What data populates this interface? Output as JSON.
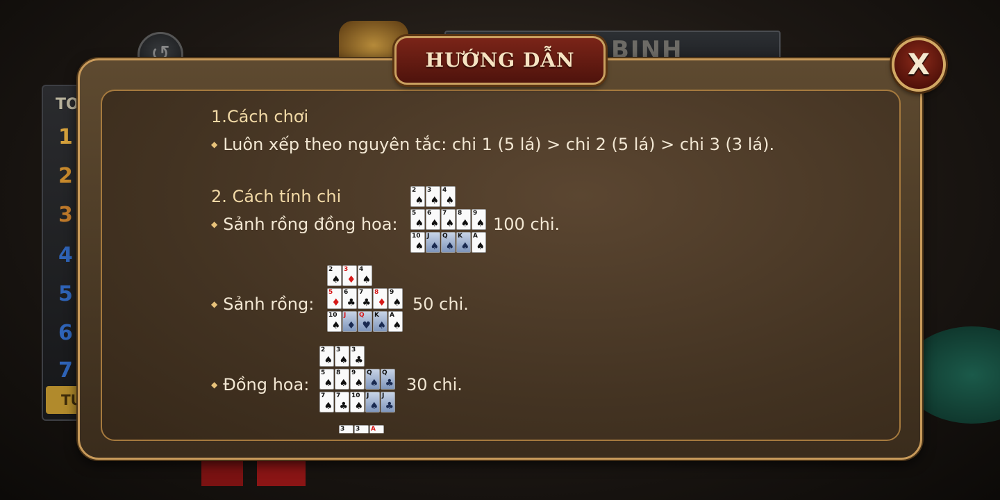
{
  "background": {
    "game_title": "BINH",
    "leaderboard_header": "TO",
    "ranks": [
      "1",
      "2",
      "3",
      "4",
      "5",
      "6",
      "7"
    ],
    "leaderboard_footer": "TU"
  },
  "dialog": {
    "title": "HƯỚNG DẪN",
    "close_label": "X",
    "section1_title": "1.Cách chơi",
    "section1_rule": "Luôn xếp theo nguyên tắc: chi 1 (5 lá) > chi 2 (5 lá) > chi 3 (3 lá).",
    "section2_title": "2. Cách tính chi",
    "hands": [
      {
        "label": "Sảnh rồng đồng hoa:",
        "score": "100 chi.",
        "rows": [
          [
            {
              "rank": "2",
              "suit": "♠"
            },
            {
              "rank": "3",
              "suit": "♠"
            },
            {
              "rank": "4",
              "suit": "♠"
            }
          ],
          [
            {
              "rank": "5",
              "suit": "♠"
            },
            {
              "rank": "6",
              "suit": "♠"
            },
            {
              "rank": "7",
              "suit": "♠"
            },
            {
              "rank": "8",
              "suit": "♠"
            },
            {
              "rank": "9",
              "suit": "♠"
            }
          ],
          [
            {
              "rank": "10",
              "suit": "♠"
            },
            {
              "rank": "J",
              "suit": "♠"
            },
            {
              "rank": "Q",
              "suit": "♠"
            },
            {
              "rank": "K",
              "suit": "♠"
            },
            {
              "rank": "A",
              "suit": "♠"
            }
          ]
        ]
      },
      {
        "label": "Sảnh rồng:",
        "score": "50 chi.",
        "rows": [
          [
            {
              "rank": "2",
              "suit": "♠"
            },
            {
              "rank": "3",
              "suit": "♦"
            },
            {
              "rank": "4",
              "suit": "♠"
            }
          ],
          [
            {
              "rank": "5",
              "suit": "♦"
            },
            {
              "rank": "6",
              "suit": "♣"
            },
            {
              "rank": "7",
              "suit": "♣"
            },
            {
              "rank": "8",
              "suit": "♦"
            },
            {
              "rank": "9",
              "suit": "♠"
            }
          ],
          [
            {
              "rank": "10",
              "suit": "♠"
            },
            {
              "rank": "J",
              "suit": "♦"
            },
            {
              "rank": "Q",
              "suit": "♥"
            },
            {
              "rank": "K",
              "suit": "♠"
            },
            {
              "rank": "A",
              "suit": "♠"
            }
          ]
        ]
      },
      {
        "label": "Đồng hoa:",
        "score": "30 chi.",
        "rows": [
          [
            {
              "rank": "2",
              "suit": "♠"
            },
            {
              "rank": "3",
              "suit": "♠"
            },
            {
              "rank": "3",
              "suit": "♣"
            }
          ],
          [
            {
              "rank": "5",
              "suit": "♠"
            },
            {
              "rank": "8",
              "suit": "♠"
            },
            {
              "rank": "9",
              "suit": "♠"
            },
            {
              "rank": "Q",
              "suit": "♠"
            },
            {
              "rank": "Q",
              "suit": "♣"
            }
          ],
          [
            {
              "rank": "7",
              "suit": "♠"
            },
            {
              "rank": "7",
              "suit": "♣"
            },
            {
              "rank": "10",
              "suit": "♠"
            },
            {
              "rank": "J",
              "suit": "♠"
            },
            {
              "rank": "J",
              "suit": "♣"
            }
          ]
        ]
      },
      {
        "label": "",
        "score": "",
        "rows": [
          [
            {
              "rank": "3",
              "suit": "♠"
            },
            {
              "rank": "3",
              "suit": "♣"
            },
            {
              "rank": "A",
              "suit": "♥"
            }
          ]
        ]
      }
    ]
  }
}
